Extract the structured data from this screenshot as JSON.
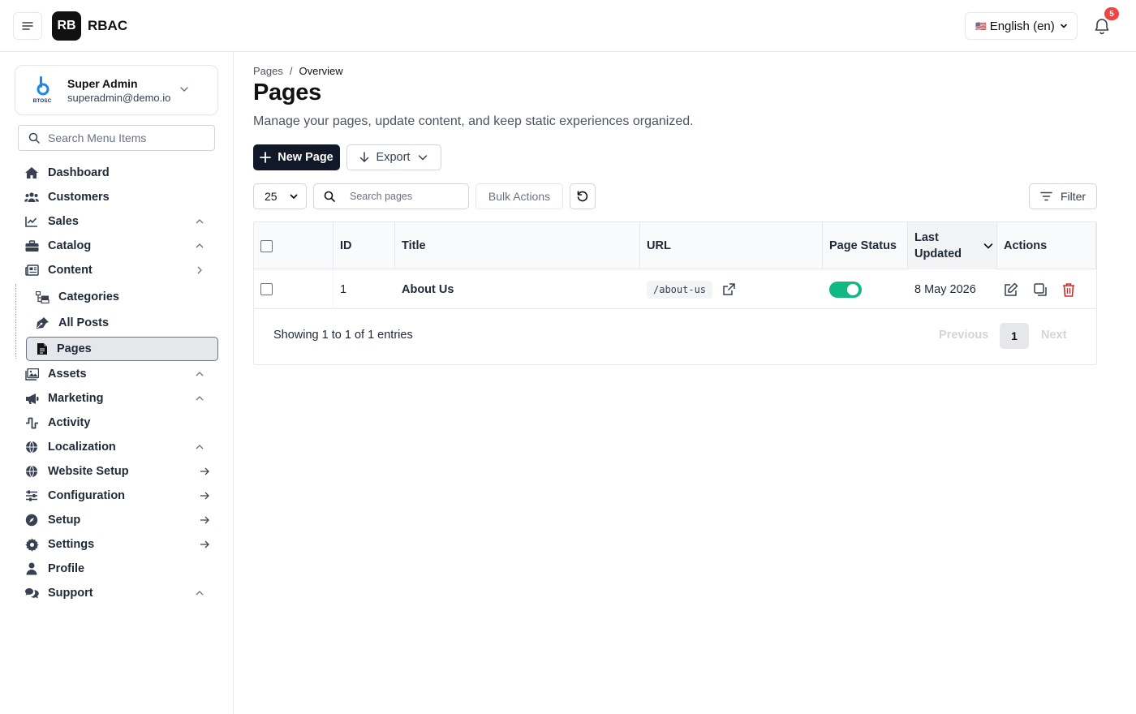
{
  "header": {
    "logo_text": "RB",
    "app_name": "RBAC",
    "language": {
      "flag": "🇺🇸",
      "label": "English (en)"
    },
    "notifications_count": "5"
  },
  "user": {
    "name": "Super Admin",
    "email": "superadmin@demo.io",
    "avatar_text": "BTOSC"
  },
  "sidebar": {
    "search_placeholder": "Search Menu Items",
    "items": [
      {
        "label": "Dashboard",
        "icon": "home-icon",
        "trail": ""
      },
      {
        "label": "Customers",
        "icon": "users-icon",
        "trail": ""
      },
      {
        "label": "Sales",
        "icon": "chart-line-icon",
        "trail": "chevron-up"
      },
      {
        "label": "Catalog",
        "icon": "briefcase-icon",
        "trail": "chevron-up"
      },
      {
        "label": "Content",
        "icon": "newspaper-icon",
        "trail": "chevron-right"
      },
      {
        "label": "Assets",
        "icon": "images-icon",
        "trail": "chevron-up"
      },
      {
        "label": "Marketing",
        "icon": "megaphone-icon",
        "trail": "chevron-up"
      },
      {
        "label": "Activity",
        "icon": "activity-icon",
        "trail": ""
      },
      {
        "label": "Localization",
        "icon": "globe-icon",
        "trail": "chevron-up"
      },
      {
        "label": "Website Setup",
        "icon": "globe-icon",
        "trail": "arrow-right"
      },
      {
        "label": "Configuration",
        "icon": "sliders-icon",
        "trail": "arrow-right"
      },
      {
        "label": "Setup",
        "icon": "compass-icon",
        "trail": "arrow-right"
      },
      {
        "label": "Settings",
        "icon": "gear-icon",
        "trail": "arrow-right"
      },
      {
        "label": "Profile",
        "icon": "user-icon",
        "trail": ""
      },
      {
        "label": "Support",
        "icon": "comments-icon",
        "trail": "chevron-up"
      }
    ],
    "content_children": [
      {
        "label": "Categories",
        "icon": "sitemap-icon"
      },
      {
        "label": "All Posts",
        "icon": "pen-nib-icon"
      },
      {
        "label": "Pages",
        "icon": "file-icon",
        "active": true
      }
    ]
  },
  "breadcrumb": {
    "root": "Pages",
    "separator": "/",
    "current": "Overview"
  },
  "page": {
    "title": "Pages",
    "description": "Manage your pages, update content, and keep static experiences organized."
  },
  "toolbar": {
    "new_label": "New Page",
    "export_label": "Export",
    "per_page": "25",
    "search_placeholder": "Search pages",
    "bulk_label": "Bulk Actions",
    "filter_label": "Filter"
  },
  "table": {
    "columns": [
      "ID",
      "Title",
      "URL",
      "Page Status",
      "Last Updated",
      "Actions"
    ],
    "rows": [
      {
        "id": "1",
        "title": "About Us",
        "url": "/about-us",
        "status": "enabled",
        "updated": "8 May 2026"
      }
    ]
  },
  "pagination": {
    "info": "Showing 1 to 1 of 1 entries",
    "previous": "Previous",
    "current": "1",
    "next": "Next"
  },
  "colors": {
    "primary": "#111827",
    "toggle_on": "#10b981",
    "danger": "#dc2626",
    "badge": "#ef4444"
  }
}
